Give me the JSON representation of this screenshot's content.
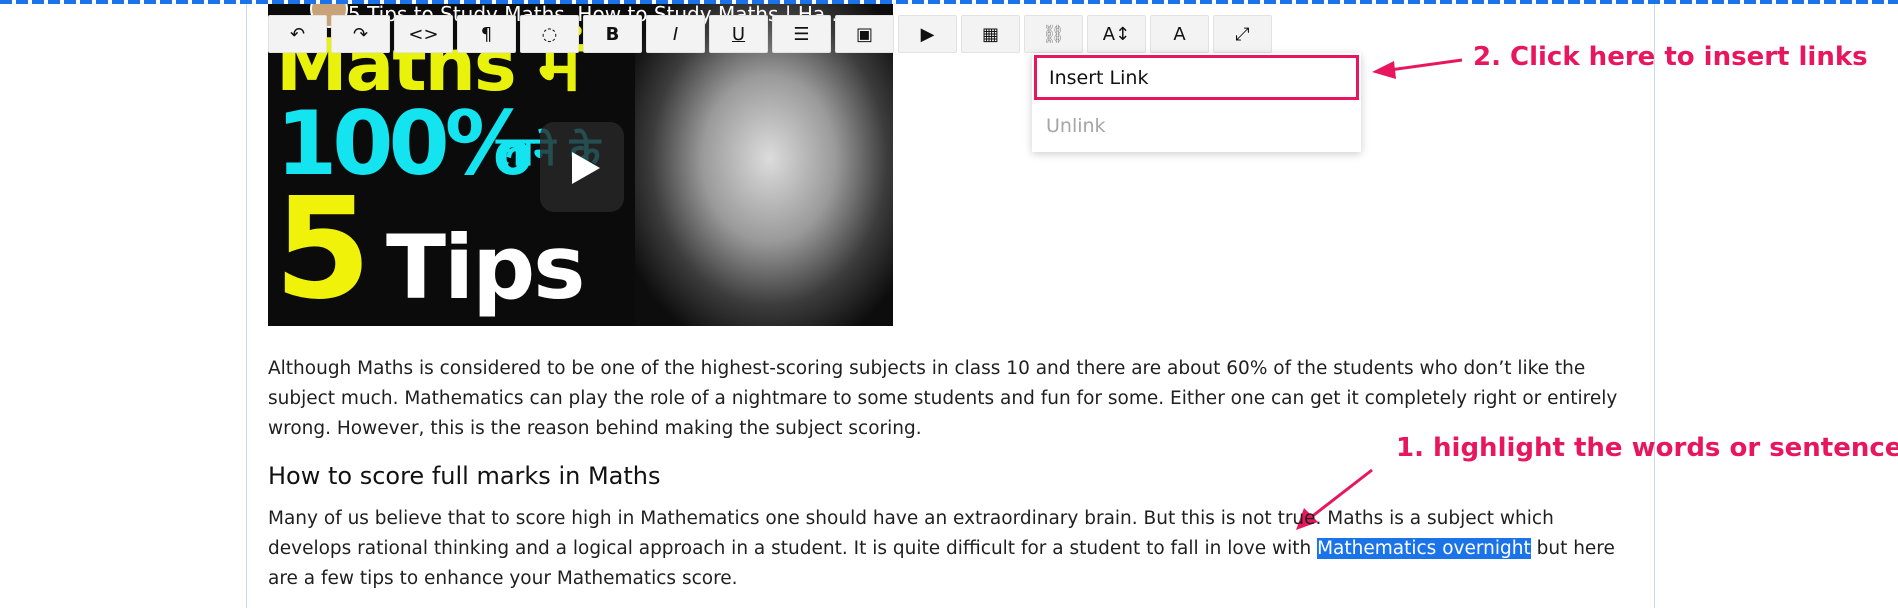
{
  "video": {
    "title": "5 Tips to Study Maths, How to Study Maths | Ha...",
    "overlay_line1": "Maths में",
    "overlay_line2": "100%",
    "overlay_line3": "लाने के",
    "overlay_line4": "5",
    "overlay_line5": "Tips"
  },
  "toolbar": {
    "buttons": [
      {
        "name": "undo-button",
        "glyph": "↶"
      },
      {
        "name": "redo-button",
        "glyph": "↷"
      },
      {
        "name": "code-view-button",
        "glyph": "<>"
      },
      {
        "name": "paragraph-format-button",
        "glyph": "¶"
      },
      {
        "name": "color-button",
        "glyph": "◌"
      },
      {
        "name": "bold-button",
        "glyph": "B"
      },
      {
        "name": "italic-button",
        "glyph": "I"
      },
      {
        "name": "underline-button",
        "glyph": "U"
      },
      {
        "name": "list-button",
        "glyph": "☰"
      },
      {
        "name": "insert-image-button",
        "glyph": "▣"
      },
      {
        "name": "insert-video-button",
        "glyph": "▶"
      },
      {
        "name": "insert-table-button",
        "glyph": "▦"
      },
      {
        "name": "link-button",
        "glyph": "⛓"
      },
      {
        "name": "font-size-button",
        "glyph": "A↕"
      },
      {
        "name": "font-style-button",
        "glyph": "A"
      },
      {
        "name": "fullscreen-button",
        "glyph": "⤢"
      }
    ]
  },
  "link_menu": {
    "insert_label": "Insert Link",
    "unlink_label": "Unlink"
  },
  "annotations": {
    "step2": "2. Click here to insert links",
    "step1": "1. highlight the words or sentence"
  },
  "article": {
    "para1": "Although Maths is considered to be one of the highest-scoring subjects in class 10 and there are about 60% of the students who don’t like the subject much. Mathematics can play the role of a nightmare to some students and fun for some. Either one can get it completely right or entirely wrong. However, this is the reason behind making the subject scoring.",
    "heading": "How to score full marks in Maths",
    "para2_before": "Many of us believe that to score high in Mathematics one should have an extraordinary brain. But this is not true. Maths is a subject which develops rational thinking and a logical approach in a student. It is quite difficult for a student to fall in love with ",
    "para2_selected": "Mathematics overnight",
    "para2_after": " but here are a few tips to enhance your Mathematics score."
  },
  "colors": {
    "accent": "#e8175d",
    "selection": "#1a73e8"
  }
}
